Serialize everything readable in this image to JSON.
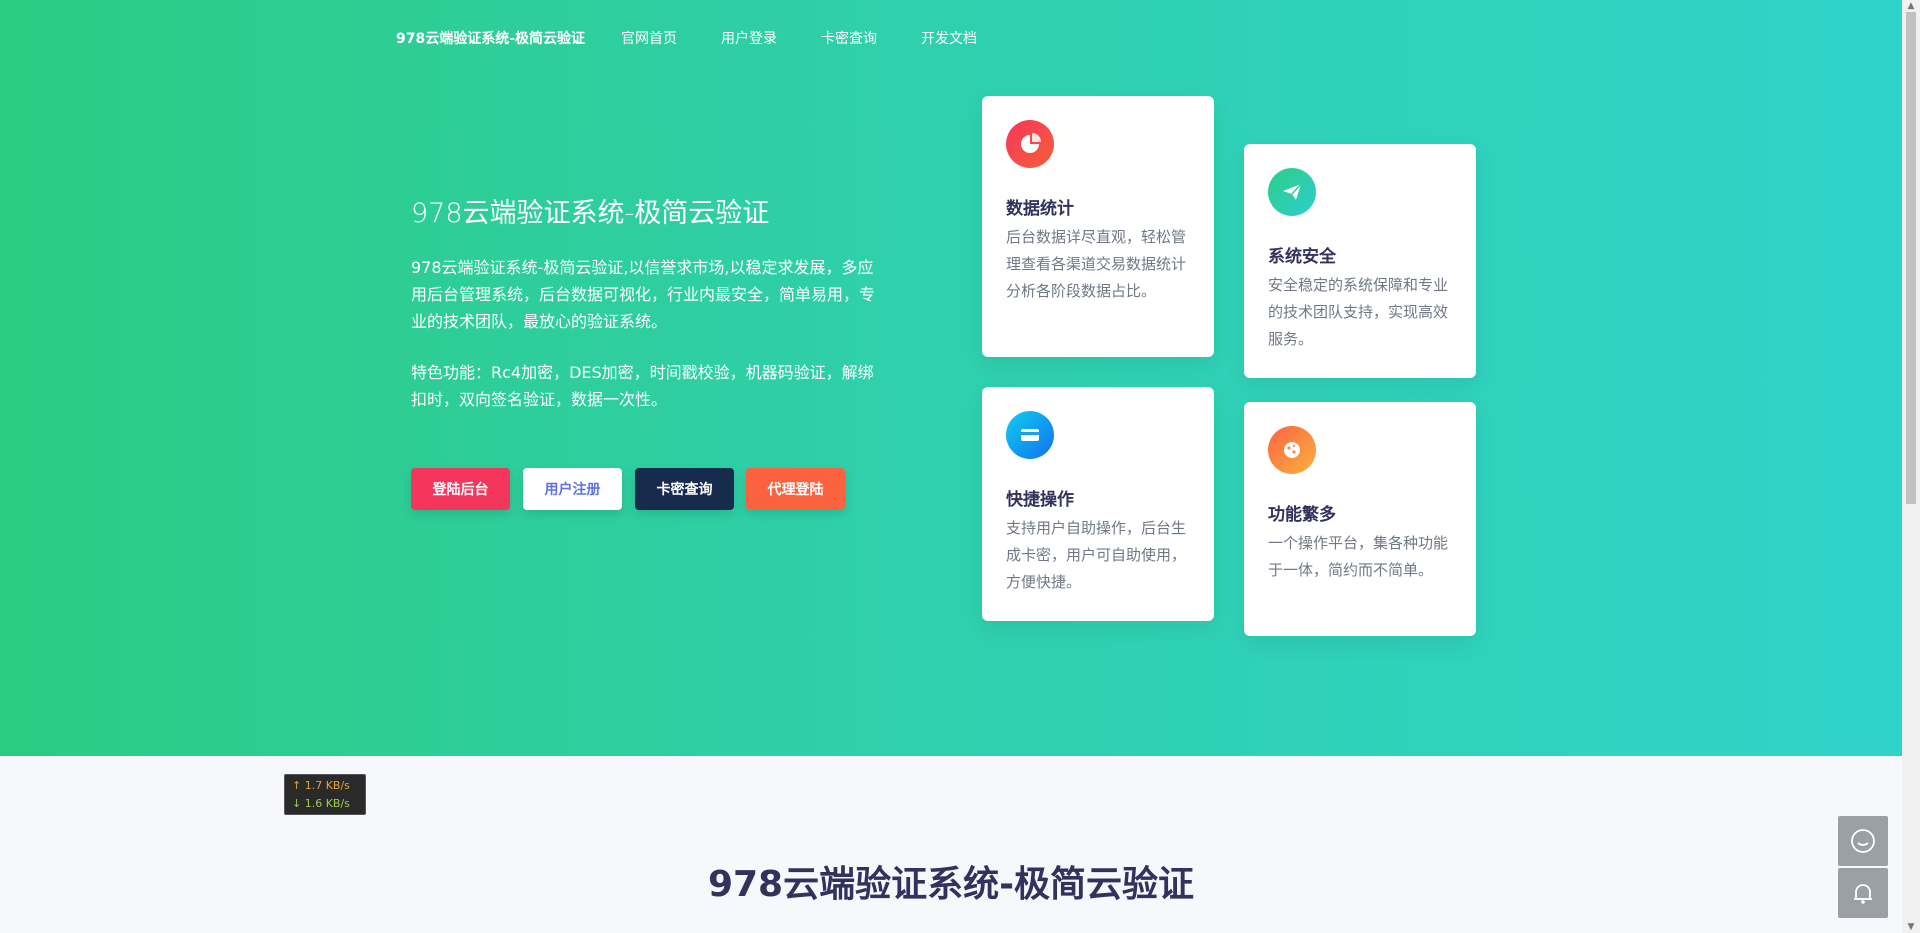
{
  "nav": {
    "brand": "978云端验证系统-极简云验证",
    "links": [
      "官网首页",
      "用户登录",
      "卡密查询",
      "开发文档"
    ]
  },
  "hero": {
    "title": "978云端验证系统-极简云验证",
    "description": "978云端验证系统-极简云验证,以信誉求市场,以稳定求发展，多应用后台管理系统，后台数据可视化，行业内最安全，简单易用，专业的技术团队，最放心的验证系统。",
    "features": "特色功能：Rc4加密，DES加密，时间戳校验，机器码验证，解绑扣时，双向签名验证，数据一次性。",
    "buttons": [
      "登陆后台",
      "用户注册",
      "卡密查询",
      "代理登陆"
    ]
  },
  "cards": [
    {
      "title": "数据统计",
      "desc": "后台数据详尽直观，轻松管理查看各渠道交易数据统计分析各阶段数据占比。",
      "icon": "pie-chart-icon",
      "color": "#f5365c"
    },
    {
      "title": "系统安全",
      "desc": "安全稳定的系统保障和专业的技术团队支持，实现高效服务。",
      "icon": "paper-plane-icon",
      "color": "#2dce89"
    },
    {
      "title": "快捷操作",
      "desc": "支持用户自助操作，后台生成卡密，用户可自助使用，方便快捷。",
      "icon": "credit-card-icon",
      "color": "#11cdef"
    },
    {
      "title": "功能繁多",
      "desc": "一个操作平台，集各种功能于一体，简约而不简单。",
      "icon": "cookie-icon",
      "color": "#fb6340"
    }
  ],
  "section": {
    "title": "978云端验证系统-极简云验证"
  },
  "net_monitor": {
    "up": "↑ 1.7 KB/s",
    "down": "↓ 1.6 KB/s"
  }
}
